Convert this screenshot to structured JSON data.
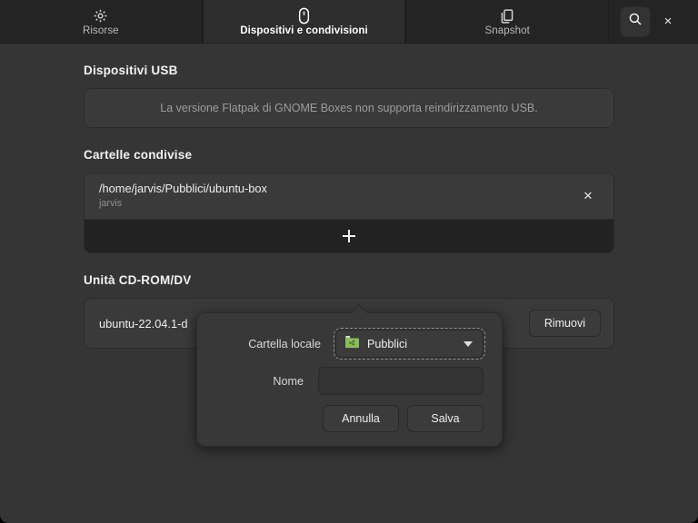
{
  "header": {
    "tabs": [
      {
        "label": "Risorse",
        "icon": "gear-icon",
        "active": false
      },
      {
        "label": "Dispositivi e condivisioni",
        "icon": "usb-device-icon",
        "active": true
      },
      {
        "label": "Snapshot",
        "icon": "copy-layers-icon",
        "active": false
      }
    ],
    "search_icon": "search-icon",
    "close_icon": "close-icon",
    "close_label": "×"
  },
  "main": {
    "usb": {
      "title": "Dispositivi USB",
      "notice": "La versione Flatpak di GNOME Boxes non supporta reindirizzamento USB."
    },
    "shared_folders": {
      "title": "Cartelle condivise",
      "rows": [
        {
          "path": "/home/jarvis/Pubblici/ubuntu-box",
          "name": "jarvis",
          "remove_icon": "close-icon",
          "remove_label": "✕"
        }
      ],
      "add_icon": "plus-icon"
    },
    "cdrom": {
      "title": "Unità CD-ROM/DV",
      "file_name": "ubuntu-22.04.1-d",
      "remove_button": "Rimuovi"
    }
  },
  "popover": {
    "folder_label": "Cartella locale",
    "folder_value": "Pubblici",
    "folder_icon": "public-folder-icon",
    "dropdown_icon": "chevron-down-icon",
    "name_label": "Nome",
    "name_value": "",
    "name_placeholder": "",
    "cancel_label": "Annulla",
    "save_label": "Salva"
  },
  "colors": {
    "window_bg": "#353535",
    "headerbar_bg": "#242424",
    "active_tab_bg": "#2e2e2e",
    "card_bg": "#3a3a3a",
    "popover_bg": "#383838",
    "accent_folder_green": "#8bbd5a",
    "text_primary": "#eeeeee",
    "text_dim": "#8f8f8f"
  }
}
